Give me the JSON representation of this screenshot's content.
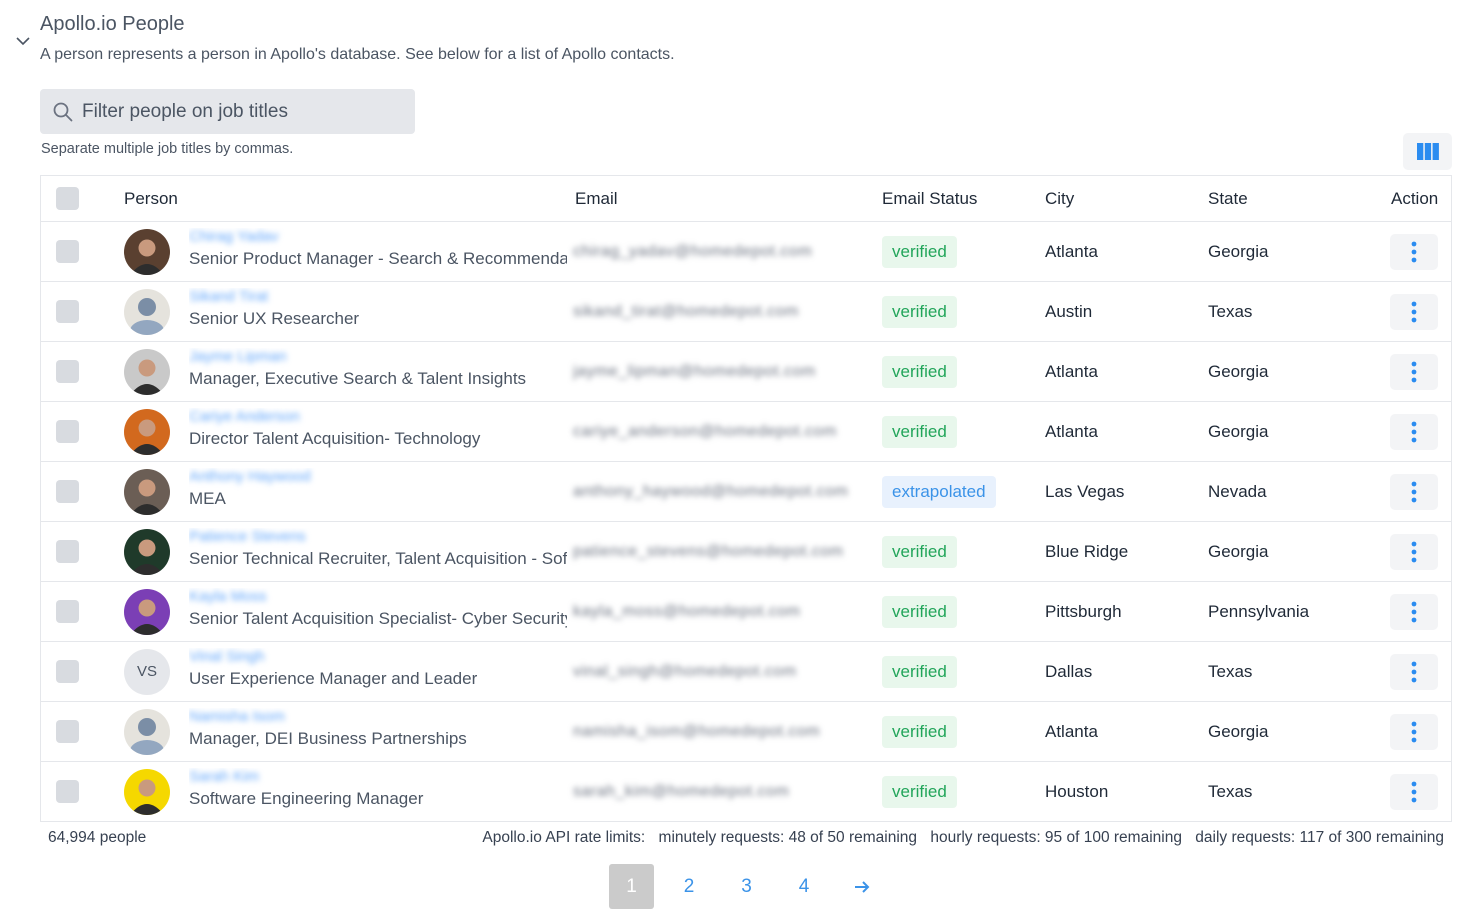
{
  "section": {
    "title": "Apollo.io People",
    "description": "A person represents a person in Apollo's database. See below for a list of Apollo contacts."
  },
  "filter": {
    "placeholder": "Filter people on job titles",
    "value": "",
    "hint": "Separate multiple job titles by commas."
  },
  "table": {
    "columns": [
      "Person",
      "Email",
      "Email Status",
      "City",
      "State",
      "Action"
    ],
    "rows": [
      {
        "name": "Chirag Yadav",
        "title": "Senior Product Manager - Search & Recommendations",
        "email": "chirag_yadav@homedepot.com",
        "email_status": "verified",
        "city": "Atlanta",
        "state": "Georgia",
        "avatar": "photo",
        "avatar_bg": "#5a4030"
      },
      {
        "name": "Sikand Tirat",
        "title": "Senior UX Researcher",
        "email": "sikand_tirat@homedepot.com",
        "email_status": "verified",
        "city": "Austin",
        "state": "Texas",
        "avatar": "placeholder",
        "avatar_bg": "#e5e3dd"
      },
      {
        "name": "Jayme Lipman",
        "title": "Manager, Executive Search & Talent Insights",
        "email": "jayme_lipman@homedepot.com",
        "email_status": "verified",
        "city": "Atlanta",
        "state": "Georgia",
        "avatar": "photo",
        "avatar_bg": "#c9c9c9"
      },
      {
        "name": "Cariye Anderson",
        "title": "Director Talent Acquisition- Technology",
        "email": "cariye_anderson@homedepot.com",
        "email_status": "verified",
        "city": "Atlanta",
        "state": "Georgia",
        "avatar": "photo",
        "avatar_bg": "#d2691e"
      },
      {
        "name": "Anthony Haywood",
        "title": "MEA",
        "email": "anthony_haywood@homedepot.com",
        "email_status": "extrapolated",
        "city": "Las Vegas",
        "state": "Nevada",
        "avatar": "photo",
        "avatar_bg": "#6b5e55"
      },
      {
        "name": "Patience Stevens",
        "title": "Senior Technical Recruiter, Talent Acquisition - Software",
        "email": "patience_stevens@homedepot.com",
        "email_status": "verified",
        "city": "Blue Ridge",
        "state": "Georgia",
        "avatar": "photo",
        "avatar_bg": "#1f3a2a"
      },
      {
        "name": "Kayla Moss",
        "title": "Senior Talent Acquisition Specialist- Cyber Security",
        "email": "kayla_moss@homedepot.com",
        "email_status": "verified",
        "city": "Pittsburgh",
        "state": "Pennsylvania",
        "avatar": "photo",
        "avatar_bg": "#7b3fb5"
      },
      {
        "name": "Vinal Singh",
        "title": "User Experience Manager and Leader",
        "email": "vinal_singh@homedepot.com",
        "email_status": "verified",
        "city": "Dallas",
        "state": "Texas",
        "avatar": "initials",
        "initials": "VS",
        "avatar_bg": "#e5e7eb"
      },
      {
        "name": "Namisha Isom",
        "title": "Manager, DEI Business Partnerships",
        "email": "namisha_isom@homedepot.com",
        "email_status": "verified",
        "city": "Atlanta",
        "state": "Georgia",
        "avatar": "placeholder",
        "avatar_bg": "#e5e3dd"
      },
      {
        "name": "Sarah Kim",
        "title": "Software Engineering Manager",
        "email": "sarah_kim@homedepot.com",
        "email_status": "verified",
        "city": "Houston",
        "state": "Texas",
        "avatar": "photo",
        "avatar_bg": "#f5d800"
      }
    ]
  },
  "footer": {
    "count": "64,994 people",
    "rate_label": "Apollo.io API rate limits:",
    "minutely": "minutely requests: 48 of 50 remaining",
    "hourly": "hourly requests: 95 of 100 remaining",
    "daily": "daily requests: 117 of 300 remaining"
  },
  "pagination": {
    "pages": [
      "1",
      "2",
      "3",
      "4"
    ],
    "current": "1",
    "next_icon": "→"
  },
  "colors": {
    "accent": "#3b93e8",
    "verified_text": "#22a55a",
    "verified_bg": "#e8f7ec",
    "extrapolated_text": "#3b93e8",
    "extrapolated_bg": "#e8f1fd"
  }
}
